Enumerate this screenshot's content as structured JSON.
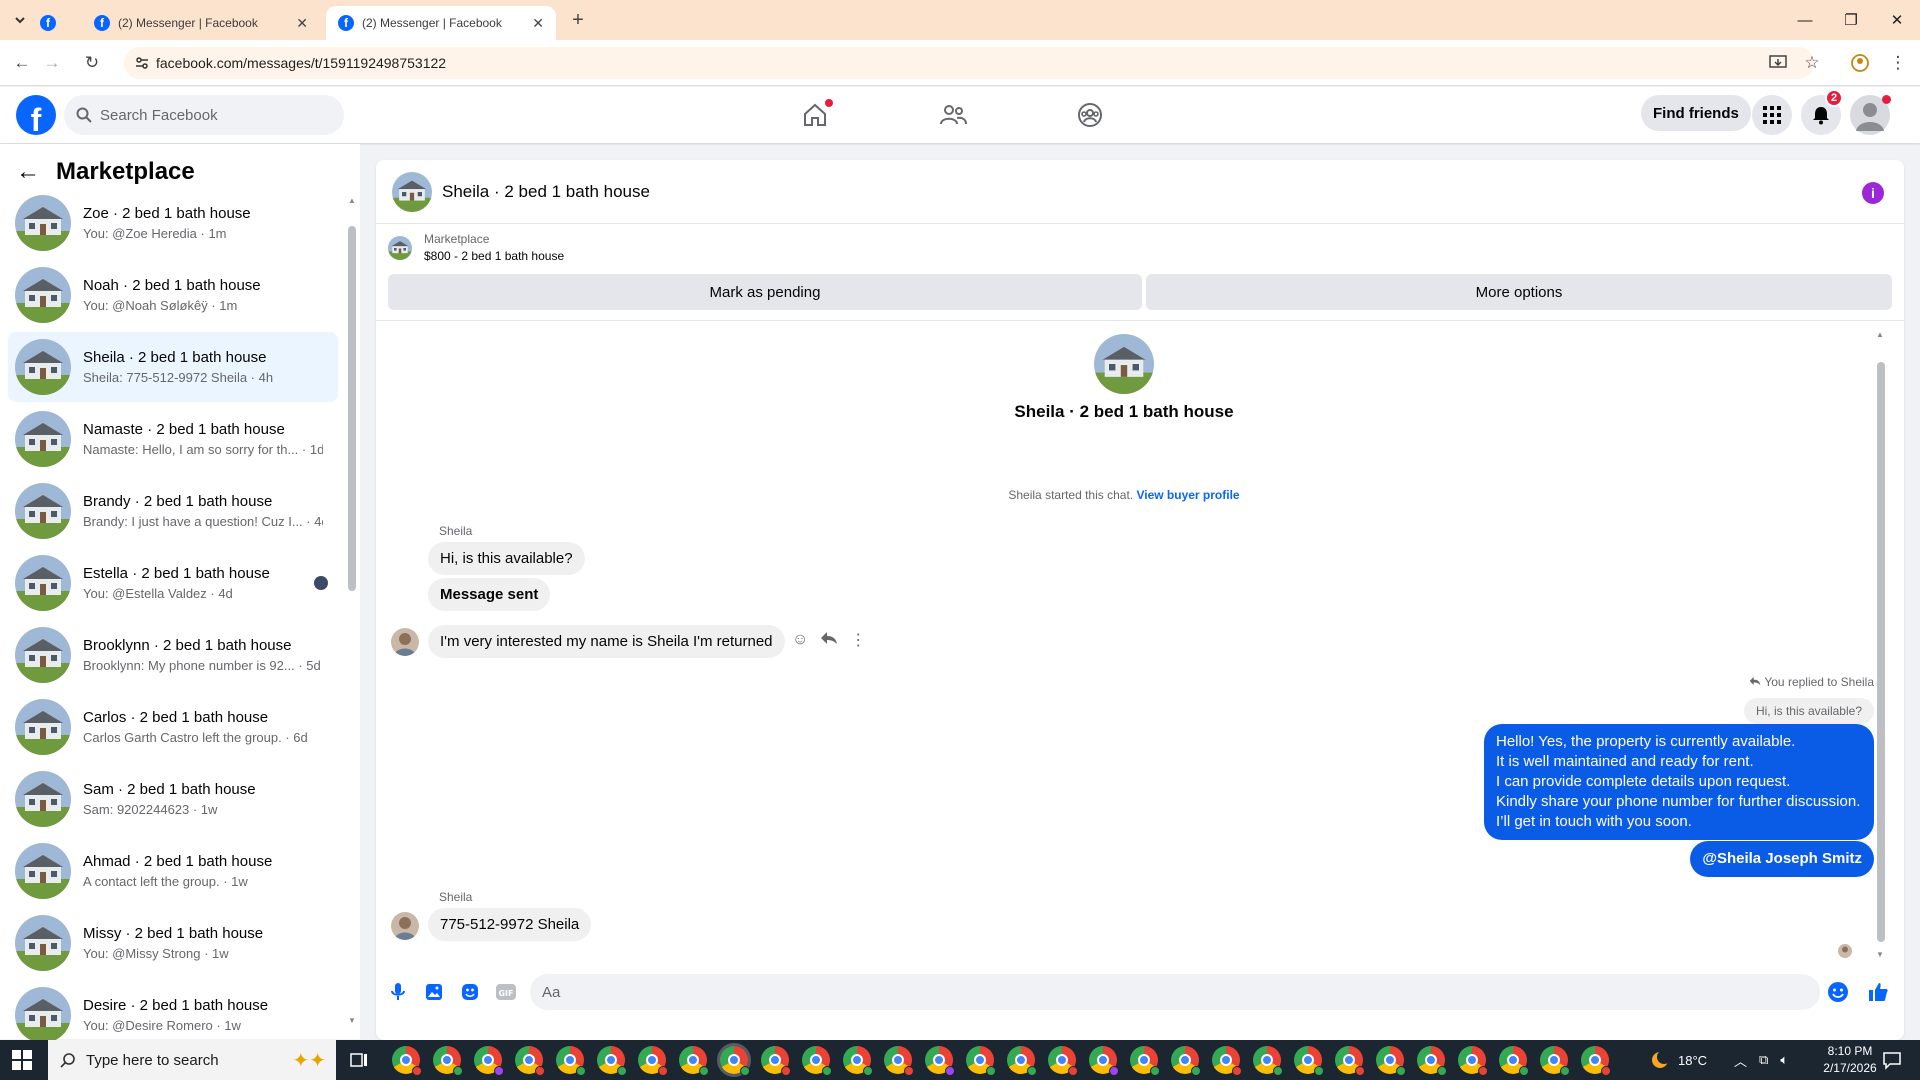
{
  "browser": {
    "tabs": [
      {
        "title": ""
      },
      {
        "title": "(2) Messenger | Facebook"
      },
      {
        "title": "(2) Messenger | Facebook"
      }
    ],
    "url": "facebook.com/messages/t/1591192498753122",
    "new_tab_symbol": "+",
    "close_symbol": "✕"
  },
  "fbnav": {
    "logo_letter": "f",
    "search_placeholder": "Search Facebook",
    "find_friends_label": "Find friends",
    "notifications_count": "2"
  },
  "marketplace": {
    "title": "Marketplace",
    "conversations": [
      {
        "name": "Zoe · 2 bed 1 bath house",
        "preview": "You: @Zoe Heredia · 1m"
      },
      {
        "name": "Noah · 2 bed 1 bath house",
        "preview": "You: @Noah Søløkêÿ · 1m"
      },
      {
        "name": "Sheila · 2 bed 1 bath house",
        "preview": "Sheila: 775-512-9972 Sheila · 4h"
      },
      {
        "name": "Namaste · 2 bed 1 bath house",
        "preview": "Namaste: Hello, I am so sorry for th... · 1d"
      },
      {
        "name": "Brandy · 2 bed 1 bath house",
        "preview": "Brandy: I just have a question! Cuz I... · 4d"
      },
      {
        "name": "Estella · 2 bed 1 bath house",
        "preview": "You: @Estella Valdez · 4d"
      },
      {
        "name": "Brooklynn · 2 bed 1 bath house",
        "preview": "Brooklynn: My phone number is 92... · 5d"
      },
      {
        "name": "Carlos · 2 bed 1 bath house",
        "preview": "Carlos Garth Castro left the group. · 6d"
      },
      {
        "name": "Sam · 2 bed 1 bath house",
        "preview": "Sam: 9202244623 · 1w"
      },
      {
        "name": "Ahmad · 2 bed 1 bath house",
        "preview": "A contact left the group. · 1w"
      },
      {
        "name": "Missy · 2 bed 1 bath house",
        "preview": "You: @Missy Strong · 1w"
      },
      {
        "name": "Desire · 2 bed 1 bath house",
        "preview": "You: @Desire Romero · 1w"
      }
    ]
  },
  "chat": {
    "title": "Sheila · 2 bed 1 bath house",
    "listing_label": "Marketplace",
    "listing_price": "$800 - 2 bed 1 bath house",
    "mark_pending_label": "Mark as pending",
    "more_options_label": "More options",
    "center_title": "Sheila · 2 bed 1 bath house",
    "started_text": "Sheila started this chat.",
    "view_buyer_profile": "View buyer profile",
    "sender_name_1": "Sheila",
    "msg_1": "Hi, is this available?",
    "msg_2": "Message sent",
    "msg_3": "I'm very interested my name is Sheila I'm returned",
    "replied_label": "You replied to Sheila",
    "quoted_text": "Hi, is this available?",
    "reply_lines": [
      "Hello! Yes, the property is currently available.",
      "It is well maintained and ready for rent.",
      "I can provide complete details upon request.",
      "Kindly share your phone number for further discussion.",
      "I’ll get in touch with you soon."
    ],
    "mention": "@Sheila Joseph Smitz",
    "sender_name_2": "Sheila",
    "msg_4": "775-512-9972 Sheila",
    "composer_placeholder": "Aa"
  },
  "taskbar": {
    "search_placeholder": "Type here to search",
    "weather": "18°C",
    "time": "8:10 PM",
    "date": "2/17/2026"
  },
  "colors": {
    "fb_blue": "#0866ff",
    "outgoing_bubble": "#0a5ce6",
    "tab_bar": "#fbe3ce",
    "active_conv": "#ebf5ff",
    "badge_red": "#e41e3f"
  }
}
